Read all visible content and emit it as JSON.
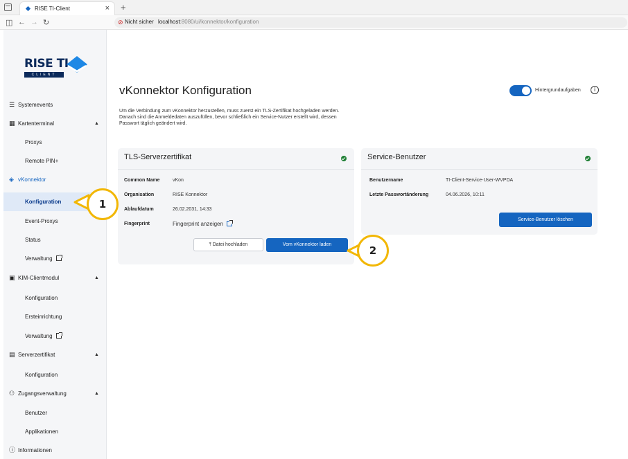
{
  "browser": {
    "tab_title": "RISE TI-Client",
    "tab_close": "×",
    "new_tab": "+",
    "not_secure": "Nicht sicher",
    "url_host": "localhost",
    "url_path": ":8080/ui/konnektor/konfiguration"
  },
  "logo": {
    "text": "RISE TI",
    "sub": "CLIENT"
  },
  "sidebar": {
    "items": [
      {
        "label": "Systemevents",
        "icon": "list-icon"
      },
      {
        "label": "Kartenterminal",
        "icon": "terminal-icon",
        "expanded": true
      },
      {
        "label": "Proxys"
      },
      {
        "label": "Remote PIN+"
      },
      {
        "label": "vKonnektor",
        "icon": "vkonnektor-icon",
        "active_section": true
      },
      {
        "label": "Konfiguration",
        "selected": true
      },
      {
        "label": "Event-Proxys"
      },
      {
        "label": "Status"
      },
      {
        "label": "Verwaltung",
        "external": true
      },
      {
        "label": "KIM-Clientmodul",
        "icon": "kim-icon",
        "expanded": true
      },
      {
        "label": "Konfiguration"
      },
      {
        "label": "Ersteinrichtung"
      },
      {
        "label": "Verwaltung",
        "external": true
      },
      {
        "label": "Serverzertifikat",
        "icon": "certificate-icon",
        "expanded": true
      },
      {
        "label": "Konfiguration"
      },
      {
        "label": "Zugangsverwaltung",
        "icon": "users-icon",
        "expanded": true
      },
      {
        "label": "Benutzer"
      },
      {
        "label": "Applikationen"
      },
      {
        "label": "Informationen",
        "icon": "info-icon"
      }
    ]
  },
  "page": {
    "title": "vKonnektor Konfiguration",
    "intro": "Um die Verbindung zum vKonnektor herzustellen, muss zuerst ein TLS-Zertifikat hochgeladen werden. Danach sind die Anmeldedaten auszufüllen, bevor schließlich ein Service-Nutzer erstellt wird, dessen Passwort täglich geändert wird.",
    "toggle_label": "Hintergrundaufgaben",
    "toggle_on": true
  },
  "tls_card": {
    "title": "TLS-Serverzertifikat",
    "status_color": "#1e7e34",
    "fields": [
      {
        "key": "Common Name",
        "value": "vKon"
      },
      {
        "key": "Organisation",
        "value": "RISE Konnektor"
      },
      {
        "key": "Ablaufdatum",
        "value": "26.02.2031, 14:33"
      },
      {
        "key": "Fingerprint",
        "value": "Fingerprint anzeigen"
      }
    ],
    "upload_button": "Datei hochladen",
    "load_button": "Vom vKonnektor laden"
  },
  "service_card": {
    "title": "Service-Benutzer",
    "status_color": "#1e7e34",
    "fields": [
      {
        "key": "Benutzername",
        "value": "TI-Client-Service-User-WVPDA"
      },
      {
        "key": "Letzte Passwortänderung",
        "value": "04.06.2026, 10:11"
      }
    ],
    "delete_button": "Service-Benutzer löschen"
  },
  "callouts": [
    "1",
    "2"
  ],
  "colors": {
    "accent": "#1565c0",
    "brand": "#0b2a5b",
    "callout": "#f2b705"
  }
}
